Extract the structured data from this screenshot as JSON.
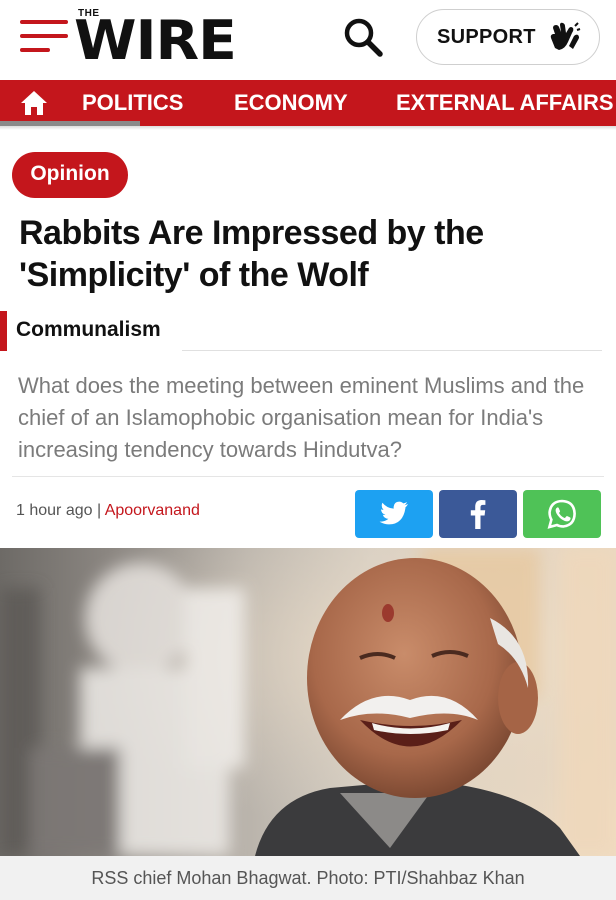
{
  "header": {
    "logo_small": "THE",
    "logo": "WIRE",
    "support_label": "SUPPORT"
  },
  "nav": {
    "items": [
      {
        "label": "POLITICS"
      },
      {
        "label": "ECONOMY"
      },
      {
        "label": "EXTERNAL AFFAIRS"
      }
    ]
  },
  "article": {
    "badge": "Opinion",
    "title": "Rabbits Are Impressed by the 'Simplicity' of the Wolf",
    "category": "Communalism",
    "summary": "What does the meeting between eminent Muslims and the chief of an Islamophobic organisation mean for India's increasing tendency towards Hindutva?",
    "time": "1 hour ago",
    "separator": "|",
    "author": "Apoorvanand",
    "caption": "RSS chief Mohan Bhagwat. Photo: PTI/Shahbaz Khan"
  },
  "share": [
    "twitter-icon",
    "facebook-icon",
    "whatsapp-icon"
  ],
  "colors": {
    "brand_red": "#c4161c",
    "twitter": "#1da1f2",
    "facebook": "#3b5998",
    "whatsapp": "#4fc257"
  }
}
